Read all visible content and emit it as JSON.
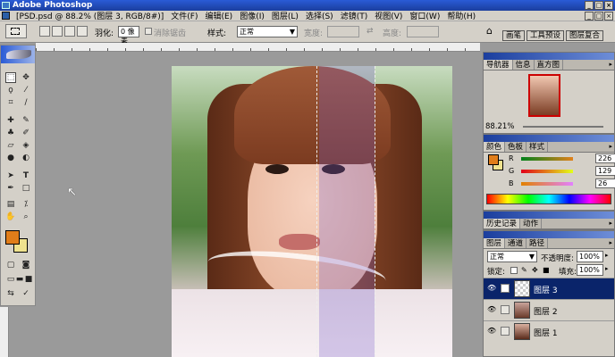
{
  "app": {
    "title": "Adobe Photoshop",
    "document_title": "[PSD.psd @ 88.2% (图层 3, RGB/8#)]"
  },
  "menu": [
    "文件(F)",
    "编辑(E)",
    "图像(I)",
    "图层(L)",
    "选择(S)",
    "滤镜(T)",
    "视图(V)",
    "窗口(W)",
    "帮助(H)"
  ],
  "options": {
    "feather_label": "羽化:",
    "feather_value": "0 像素",
    "antialias_label": "消除锯齿",
    "style_label": "样式:",
    "style_value": "正常",
    "width_label": "宽度:",
    "height_label": "高度:",
    "wells": [
      "画笔",
      "工具预设",
      "图层复合"
    ]
  },
  "navigator": {
    "tabs": [
      "导航器",
      "信息",
      "直方图"
    ],
    "zoom": "88.21%"
  },
  "color_panel": {
    "tabs": [
      "颜色",
      "色板",
      "样式"
    ],
    "channels": [
      {
        "label": "R",
        "value": "226"
      },
      {
        "label": "G",
        "value": "129"
      },
      {
        "label": "B",
        "value": "26"
      }
    ],
    "foreground": "#e07d1a",
    "background": "#efe28e"
  },
  "history_panel": {
    "tabs": [
      "历史记录",
      "动作"
    ]
  },
  "layers_panel": {
    "tabs": [
      "图层",
      "通道",
      "路径"
    ],
    "blend_mode": "正常",
    "opacity_label": "不透明度:",
    "opacity_value": "100%",
    "lock_label": "锁定:",
    "fill_label": "填充:",
    "fill_value": "100%",
    "layers": [
      {
        "name": "图层 3",
        "selected": true
      },
      {
        "name": "图层 2",
        "selected": false
      },
      {
        "name": "图层 1",
        "selected": false
      }
    ]
  },
  "icons": [
    "ps-logo-icon",
    "minimize-icon",
    "maximize-icon",
    "close-icon",
    "marquee-icon",
    "move-icon",
    "lasso-icon",
    "magic-wand-icon",
    "crop-icon",
    "slice-icon",
    "healing-icon",
    "brush-icon",
    "stamp-icon",
    "history-brush-icon",
    "eraser-icon",
    "bucket-icon",
    "blur-icon",
    "dodge-icon",
    "path-select-icon",
    "type-icon",
    "pen-icon",
    "shape-icon",
    "notes-icon",
    "eyedropper-icon",
    "hand-icon",
    "zoom-icon",
    "eye-icon",
    "link-icon",
    "mouse-cursor-icon"
  ]
}
